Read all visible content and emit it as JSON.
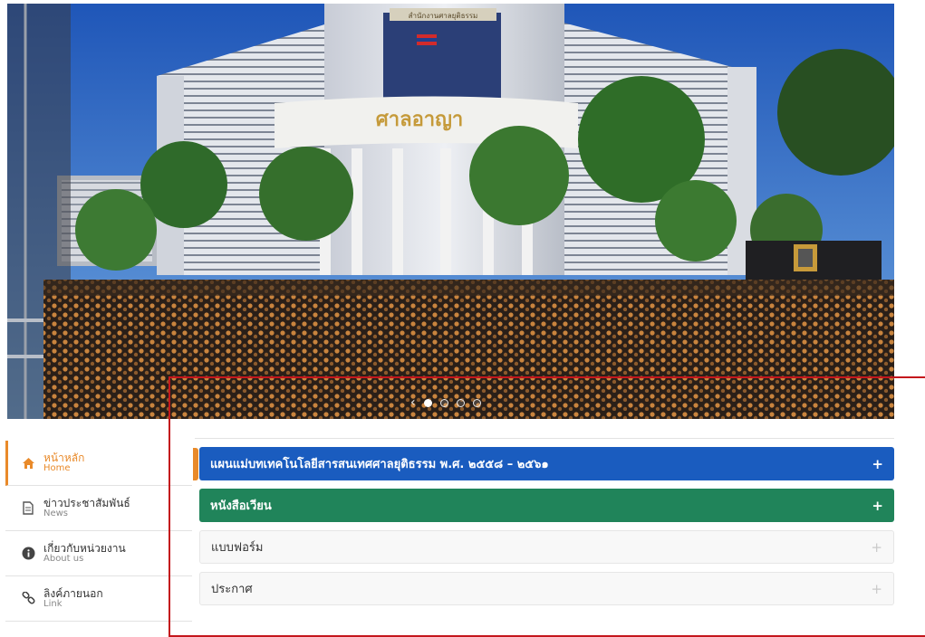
{
  "hero": {
    "building_sign": "ศาลอาญา",
    "building_plaque": "สำนักงานศาลยุติธรรม",
    "slides": 4,
    "active_slide": 1
  },
  "sidebar": {
    "items": [
      {
        "th": "หน้าหลัก",
        "en": "Home",
        "icon": "home-icon",
        "active": true
      },
      {
        "th": "ข่าวประชาสัมพันธ์",
        "en": "News",
        "icon": "document-icon",
        "active": false
      },
      {
        "th": "เกี่ยวกับหน่วยงาน",
        "en": "About us",
        "icon": "info-icon",
        "active": false
      },
      {
        "th": "ลิงค์ภายนอก",
        "en": "Link",
        "icon": "link-icon",
        "active": false
      }
    ]
  },
  "accordion": {
    "items": [
      {
        "label": "แผนแม่บทเทคโนโลยีสารสนเทศศาลยุติธรรม พ.ศ. ๒๕๕๘ – ๒๕๖๑",
        "style": "blue",
        "toggle": "+"
      },
      {
        "label": "หนังสือเวียน",
        "style": "green",
        "toggle": "+"
      },
      {
        "label": "แบบฟอร์ม",
        "style": "plain",
        "toggle": "+"
      },
      {
        "label": "ประกาศ",
        "style": "plain",
        "toggle": "+"
      }
    ]
  },
  "colors": {
    "accent_orange": "#e98a2a",
    "blue_panel": "#1a5cbf",
    "green_panel": "#20845a",
    "annotation_red": "#c4161c"
  }
}
